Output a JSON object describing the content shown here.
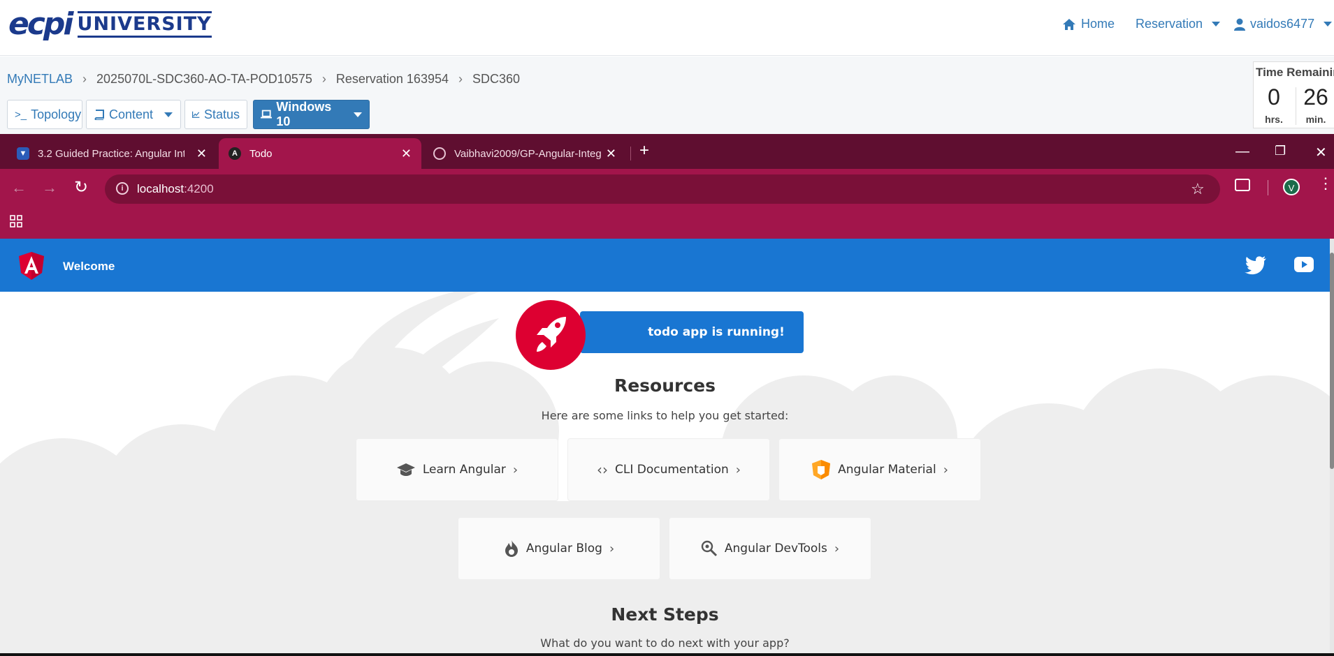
{
  "header": {
    "logo_mark": "ecpi",
    "logo_text": "UNIVERSITY",
    "nav": {
      "home": "Home",
      "reservation": "Reservation",
      "user": "vaidos6477"
    }
  },
  "breadcrumb": [
    "MyNETLAB",
    "2025070L-SDC360-AO-TA-POD10575",
    "Reservation 163954",
    "SDC360"
  ],
  "lab_toolbar": {
    "topology": "Topology",
    "topology_prefix": ">_",
    "content": "Content",
    "status": "Status",
    "windows": "Windows 10"
  },
  "timer": {
    "title": "Time Remaining",
    "hours": "0",
    "hours_unit": "hrs.",
    "minutes": "26",
    "minutes_unit": "min."
  },
  "browser": {
    "tabs": [
      {
        "title": "3.2 Guided Practice: Angular Int",
        "active": false
      },
      {
        "title": "Todo",
        "active": true
      },
      {
        "title": "Vaibhavi2009/GP-Angular-Integ",
        "active": false
      }
    ],
    "new_tab": "+",
    "url_host": "localhost",
    "url_port": ":4200",
    "profile_initial": "V"
  },
  "app": {
    "toolbar_title": "Welcome",
    "running_text": "todo app is running!",
    "resources_title": "Resources",
    "resources_subtitle": "Here are some links to help you get started:",
    "cards": [
      {
        "label": "Learn Angular",
        "icon": "graduation-cap-icon"
      },
      {
        "label": "CLI Documentation",
        "icon": "code-brackets-icon"
      },
      {
        "label": "Angular Material",
        "icon": "angular-material-icon"
      },
      {
        "label": "Angular Blog",
        "icon": "flame-icon"
      },
      {
        "label": "Angular DevTools",
        "icon": "magnifier-icon"
      }
    ],
    "next_steps_title": "Next Steps",
    "next_steps_subtitle": "What do you want to do next with your app?"
  },
  "colors": {
    "accent": "#337ab7",
    "chrome_dark": "#5f0e30",
    "chrome": "#a2154b",
    "angular_blue": "#1976d2",
    "angular_red": "#dd0031"
  }
}
